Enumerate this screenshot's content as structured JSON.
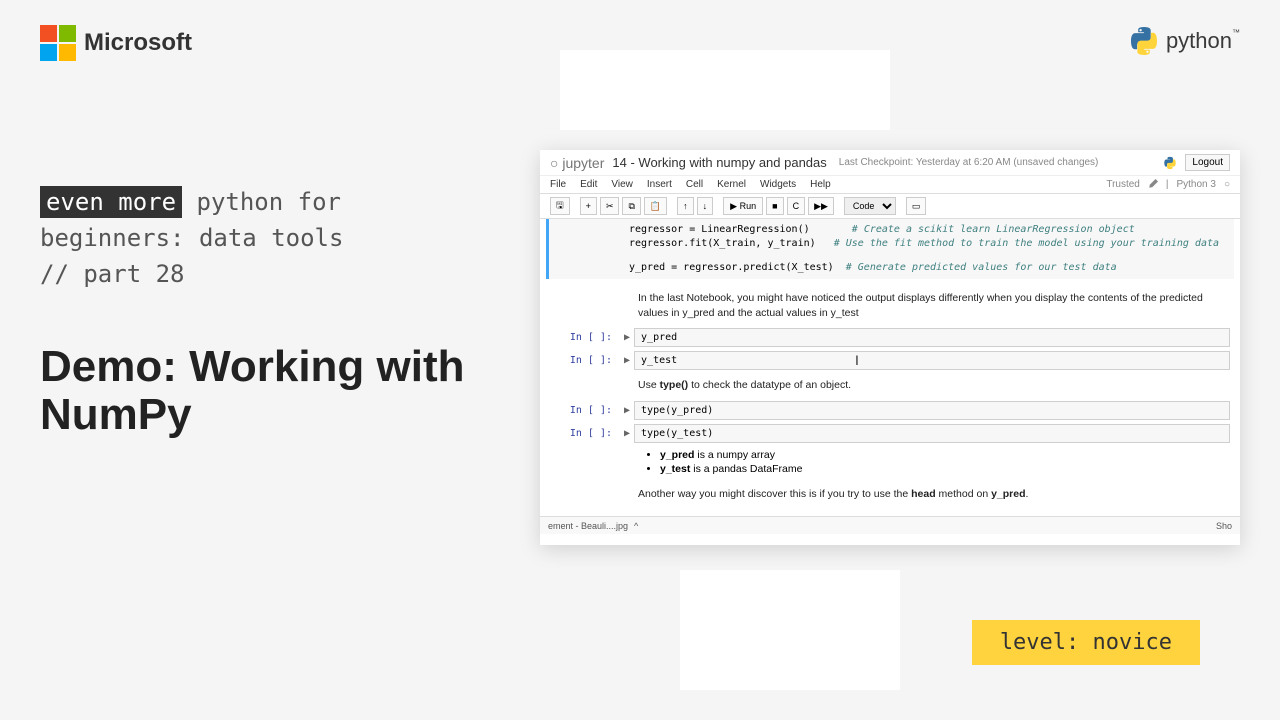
{
  "header": {
    "microsoft": "Microsoft",
    "python": "python",
    "ms_colors": {
      "tl": "#f25022",
      "tr": "#7fba00",
      "bl": "#00a4ef",
      "br": "#ffb900"
    }
  },
  "left": {
    "highlight": "even more",
    "line1_rest": " python for",
    "line2": "beginners: data tools",
    "line3": "// part 28",
    "title": "Demo: Working with NumPy"
  },
  "level_badge": "level: novice",
  "notebook": {
    "jupyter_label": "jupyter",
    "title": "14 - Working with numpy and pandas",
    "checkpoint": "Last Checkpoint: Yesterday at 6:20 AM  (unsaved changes)",
    "logout": "Logout",
    "menu": [
      "File",
      "Edit",
      "View",
      "Insert",
      "Cell",
      "Kernel",
      "Widgets",
      "Help"
    ],
    "menu_right": {
      "trusted": "Trusted",
      "kernel": "Python 3"
    },
    "toolbar": {
      "save": "💾",
      "add": "+",
      "cut": "✂",
      "copy": "⧉",
      "paste": "📋",
      "up": "↑",
      "down": "↓",
      "run": "▶ Run",
      "stop": "■",
      "restart": "C",
      "ff": "▶▶",
      "celltype": "Code",
      "cmd": "⌘"
    },
    "top_code": {
      "l1a": "regressor = LinearRegression()",
      "l1c": "# Create a scikit learn LinearRegression object",
      "l2a": "regressor.fit(X_train, y_train)",
      "l2c": "# Use the fit method to train the model using your training data",
      "l3a": "y_pred = regressor.predict(X_test)",
      "l3c": "# Generate predicted values for our test data"
    },
    "md1": "In the last Notebook, you might have noticed the output displays differently when you display the contents of the predicted values in y_pred and the actual values in y_test",
    "md2_pre": "Use ",
    "md2_bold": "type()",
    "md2_post": " to check the datatype of an object.",
    "cells": [
      {
        "prompt": "In [ ]:",
        "code": "y_pred"
      },
      {
        "prompt": "In [ ]:",
        "code": "y_test"
      },
      {
        "prompt": "In [ ]:",
        "code": "type(y_pred)"
      },
      {
        "prompt": "In [ ]:",
        "code": "type(y_test)"
      }
    ],
    "list": {
      "i1_b": "y_pred",
      "i1_t": " is a numpy array",
      "i2_b": "y_test",
      "i2_t": " is a pandas DataFrame"
    },
    "md3_pre": "Another way you might discover this is if you try to use the ",
    "md3_b1": "head",
    "md3_mid": " method on ",
    "md3_b2": "y_pred",
    "md3_post": ".",
    "taskbar_left": "ement - Beauli....jpg",
    "taskbar_right": "Sho"
  }
}
